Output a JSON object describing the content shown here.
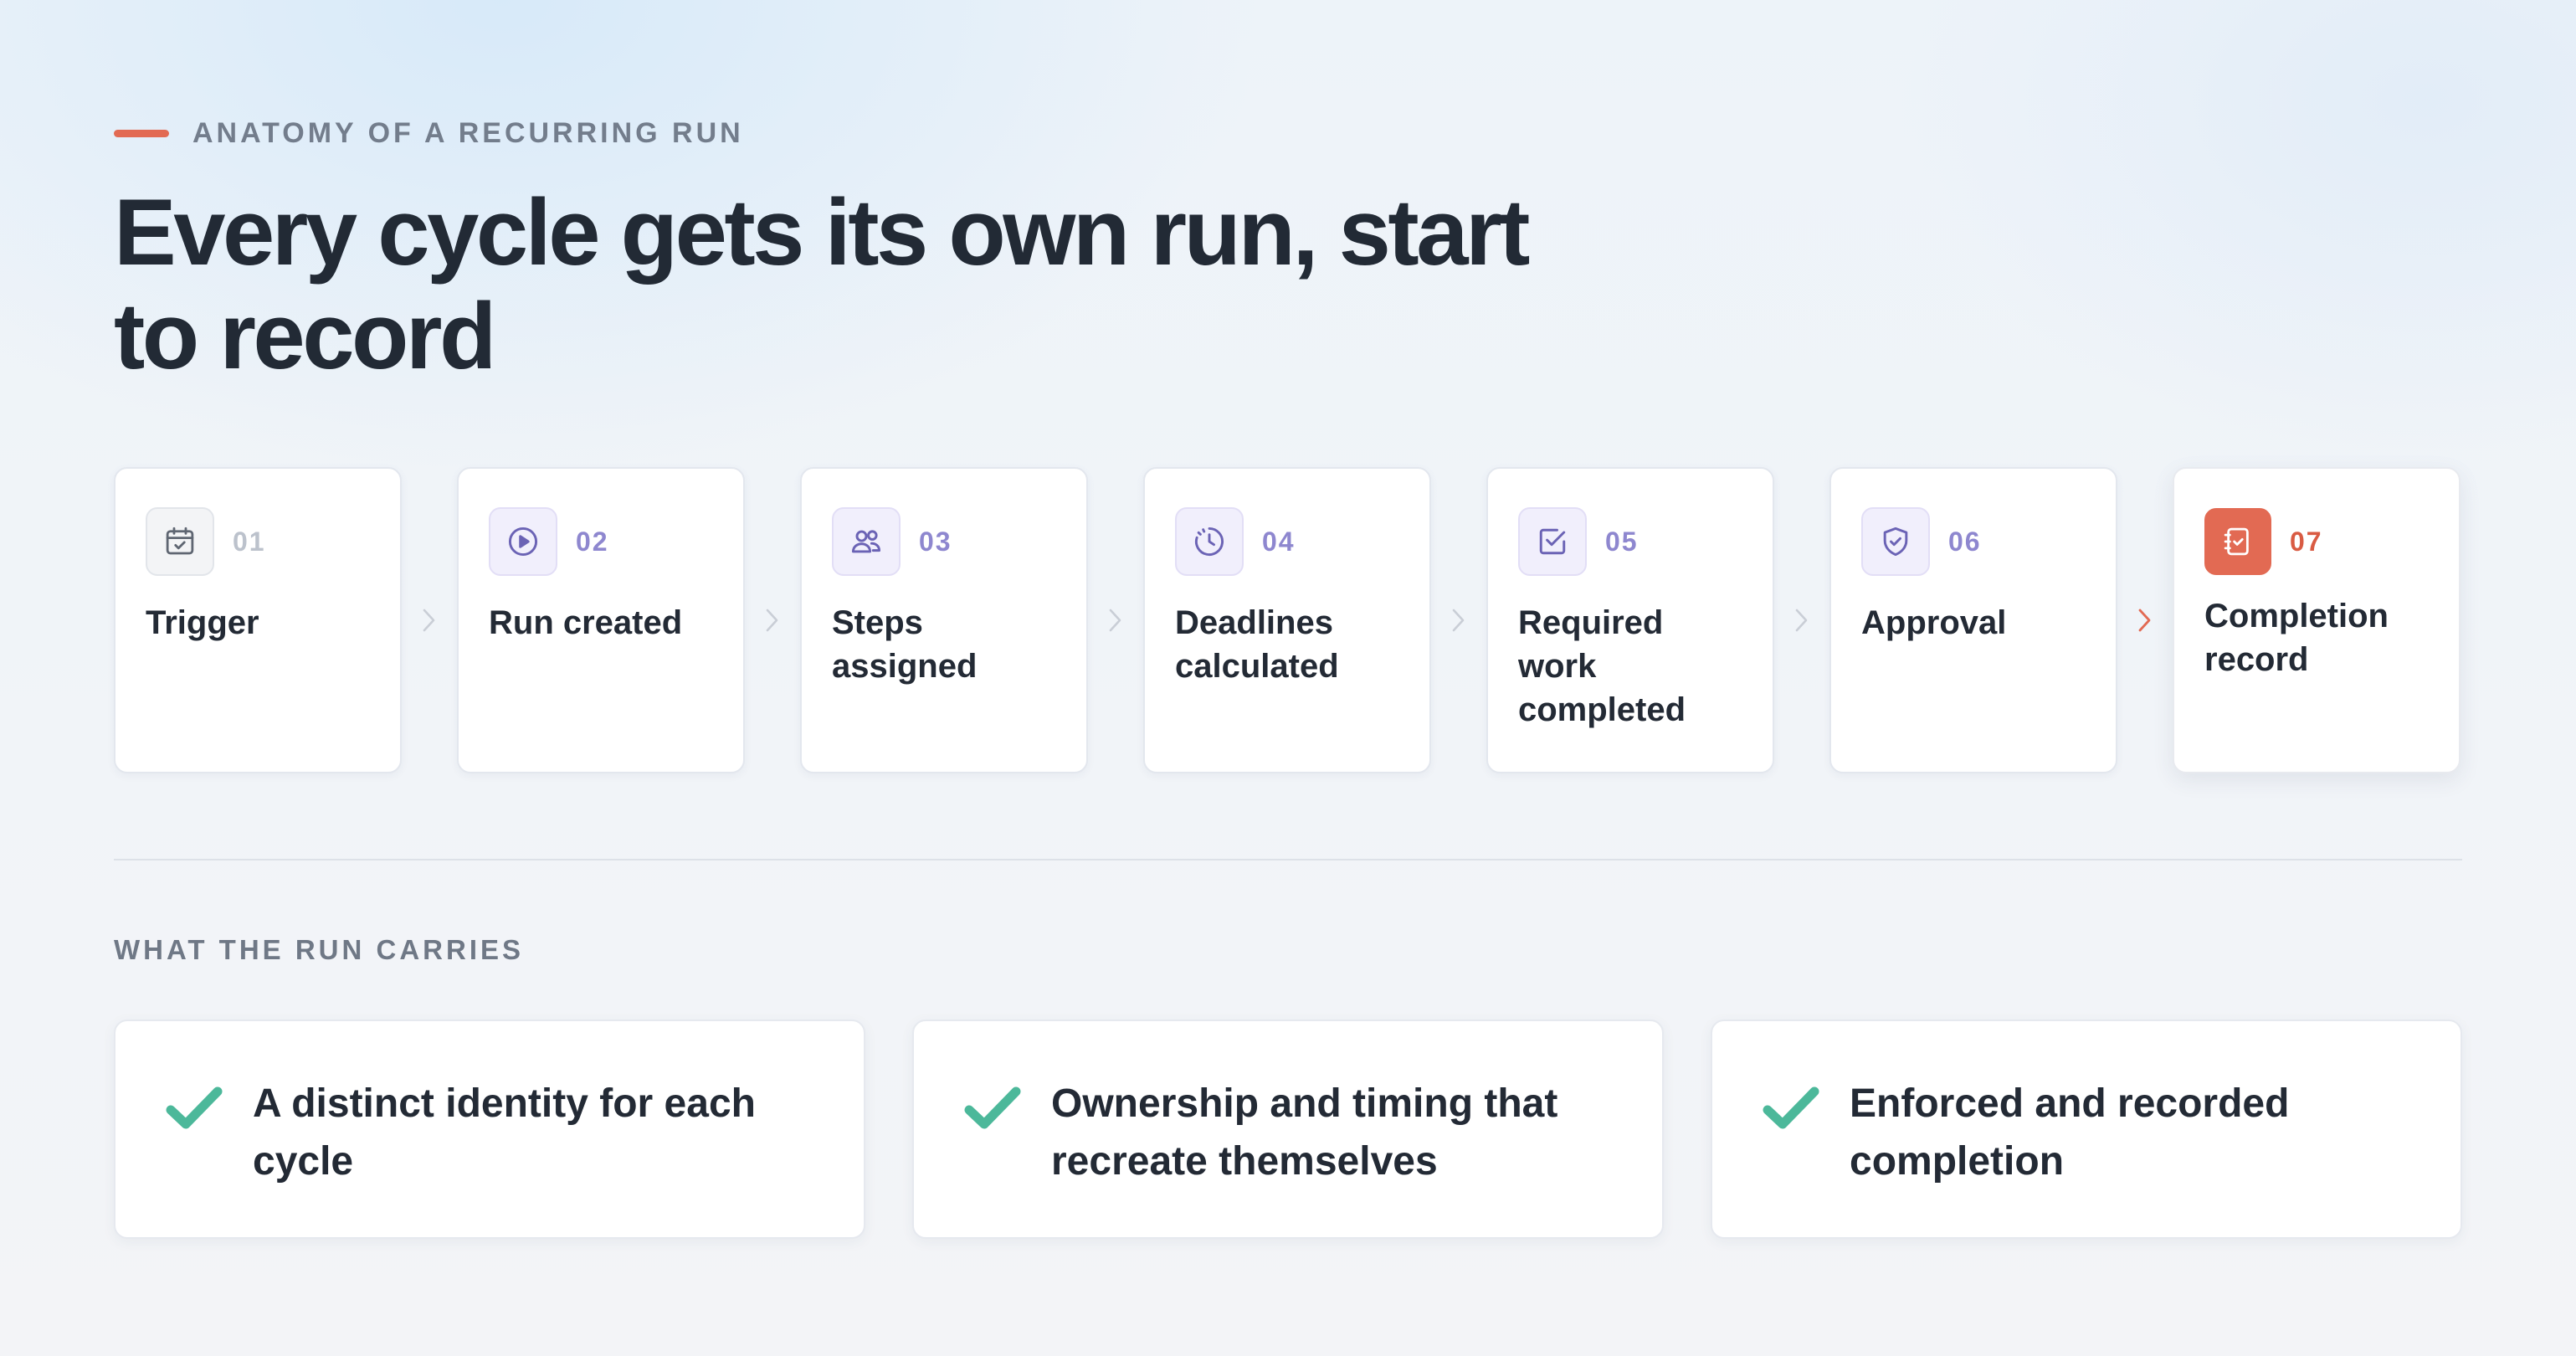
{
  "eyebrow": "ANATOMY OF A RECURRING RUN",
  "title": "Every cycle gets its own run, start to record",
  "steps": [
    {
      "number": "01",
      "label": "Trigger",
      "icon": "calendar-check-icon"
    },
    {
      "number": "02",
      "label": "Run created",
      "icon": "play-circle-icon"
    },
    {
      "number": "03",
      "label": "Steps assigned",
      "icon": "users-icon"
    },
    {
      "number": "04",
      "label": "Deadlines calculated",
      "icon": "clock-icon"
    },
    {
      "number": "05",
      "label": "Required work completed",
      "icon": "checkbox-icon"
    },
    {
      "number": "06",
      "label": "Approval",
      "icon": "shield-check-icon"
    },
    {
      "number": "07",
      "label": "Completion record",
      "icon": "record-book-icon"
    }
  ],
  "carries_heading": "WHAT THE RUN CARRIES",
  "carries": [
    {
      "text": "A distinct identity for each cycle",
      "icon": "check-icon"
    },
    {
      "text": "Ownership and timing that recreate themselves",
      "icon": "check-icon"
    },
    {
      "text": "Enforced and recorded completion",
      "icon": "check-icon"
    }
  ],
  "colors": {
    "accent": "#e26a53",
    "step_purple": "#8e87cf",
    "check_green": "#4cb89a",
    "heading": "#222a35"
  }
}
